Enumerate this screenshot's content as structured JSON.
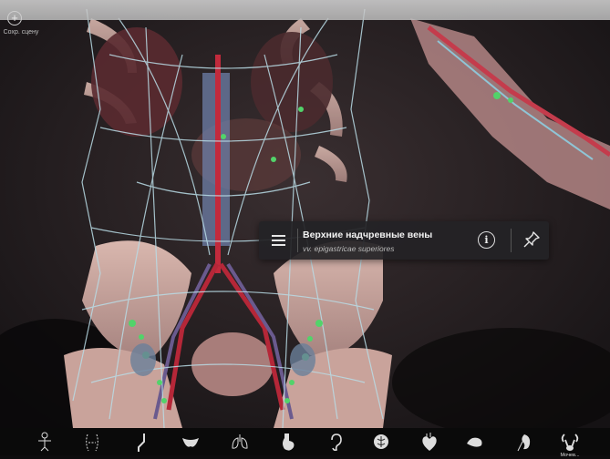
{
  "toolbar": {
    "save_label": "Сохр. сцену"
  },
  "selection": {
    "name_ru": "Верхние надчревные вены",
    "name_latin": "vv. epigastricae superiores"
  },
  "bottom_tools": [
    {
      "icon": "skeleton-icon"
    },
    {
      "icon": "muscle-icon"
    },
    {
      "icon": "ligament-icon"
    },
    {
      "icon": "joint-icon"
    },
    {
      "icon": "pelvis-icon"
    },
    {
      "icon": "lungs-icon"
    },
    {
      "icon": "stomach-icon"
    },
    {
      "icon": "ear-icon"
    },
    {
      "icon": "nervous-system-icon"
    },
    {
      "icon": "heart-icon"
    },
    {
      "icon": "digestive-icon"
    },
    {
      "icon": "kidney-icon"
    },
    {
      "icon": "urinary-icon",
      "label": "Мочев..."
    }
  ]
}
